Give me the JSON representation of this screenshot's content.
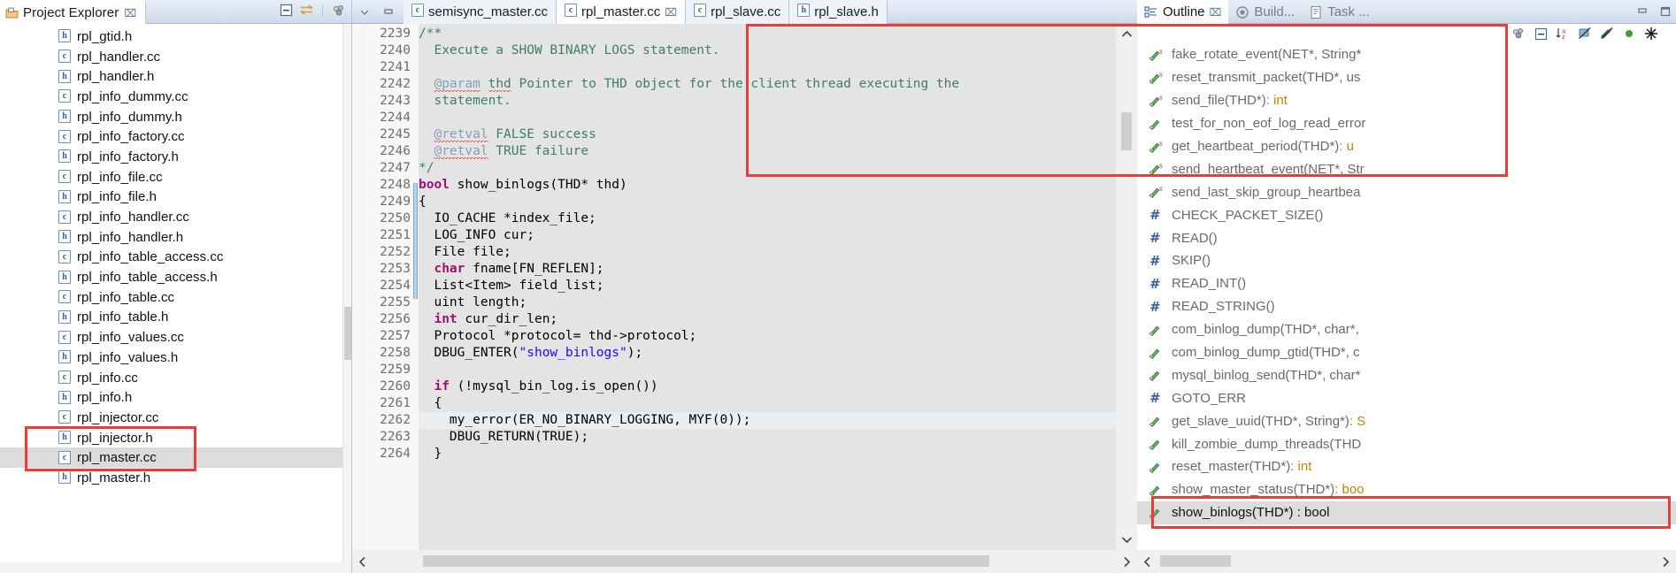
{
  "project_explorer": {
    "title": "Project Explorer",
    "close_label": "⌧",
    "icons": [
      "collapse-all-icon",
      "link-with-editor-icon",
      "view-menu-icon"
    ],
    "files": [
      {
        "name": "rpl_gtid.h",
        "type": "h"
      },
      {
        "name": "rpl_handler.cc",
        "type": "c"
      },
      {
        "name": "rpl_handler.h",
        "type": "h"
      },
      {
        "name": "rpl_info_dummy.cc",
        "type": "c"
      },
      {
        "name": "rpl_info_dummy.h",
        "type": "h"
      },
      {
        "name": "rpl_info_factory.cc",
        "type": "c"
      },
      {
        "name": "rpl_info_factory.h",
        "type": "h"
      },
      {
        "name": "rpl_info_file.cc",
        "type": "c"
      },
      {
        "name": "rpl_info_file.h",
        "type": "h"
      },
      {
        "name": "rpl_info_handler.cc",
        "type": "c"
      },
      {
        "name": "rpl_info_handler.h",
        "type": "h"
      },
      {
        "name": "rpl_info_table_access.cc",
        "type": "c"
      },
      {
        "name": "rpl_info_table_access.h",
        "type": "h"
      },
      {
        "name": "rpl_info_table.cc",
        "type": "c"
      },
      {
        "name": "rpl_info_table.h",
        "type": "h"
      },
      {
        "name": "rpl_info_values.cc",
        "type": "c"
      },
      {
        "name": "rpl_info_values.h",
        "type": "h"
      },
      {
        "name": "rpl_info.cc",
        "type": "c"
      },
      {
        "name": "rpl_info.h",
        "type": "h"
      },
      {
        "name": "rpl_injector.cc",
        "type": "c"
      },
      {
        "name": "rpl_injector.h",
        "type": "h"
      },
      {
        "name": "rpl_master.cc",
        "type": "c",
        "selected": true
      },
      {
        "name": "rpl_master.h",
        "type": "h"
      }
    ]
  },
  "editor": {
    "panel_controls": [
      "view-menu-icon",
      "minimize-icon",
      "maximize-icon"
    ],
    "tabs": [
      {
        "label": "semisync_master.cc",
        "active": false,
        "closable": false
      },
      {
        "label": "rpl_master.cc",
        "active": true,
        "closable": true
      },
      {
        "label": "rpl_slave.cc",
        "active": false,
        "closable": false
      },
      {
        "label": "rpl_slave.h",
        "active": false,
        "closable": false,
        "type": "h"
      }
    ],
    "close_label": "⌧",
    "first_line_number": 2239,
    "lines": [
      {
        "n": 2239,
        "fold": true,
        "tokens": [
          {
            "t": "/**",
            "c": "cmt"
          }
        ]
      },
      {
        "n": 2240,
        "tokens": [
          {
            "t": "  Execute a SHOW BINARY LOGS statement.",
            "c": "cmt"
          }
        ]
      },
      {
        "n": 2241,
        "tokens": [
          {
            "t": "",
            "c": "cmt"
          }
        ]
      },
      {
        "n": 2242,
        "tokens": [
          {
            "t": "  ",
            "c": "cmt"
          },
          {
            "t": "@param",
            "c": "cmt-tag squiggle"
          },
          {
            "t": " ",
            "c": "cmt"
          },
          {
            "t": "thd",
            "c": "cmt squiggle"
          },
          {
            "t": " Pointer to THD object for the client thread executing the",
            "c": "cmt"
          }
        ]
      },
      {
        "n": 2243,
        "tokens": [
          {
            "t": "  statement.",
            "c": "cmt"
          }
        ]
      },
      {
        "n": 2244,
        "tokens": [
          {
            "t": "",
            "c": "cmt"
          }
        ]
      },
      {
        "n": 2245,
        "tokens": [
          {
            "t": "  ",
            "c": "cmt"
          },
          {
            "t": "@retval",
            "c": "cmt-tag squiggle"
          },
          {
            "t": " FALSE success",
            "c": "cmt"
          }
        ]
      },
      {
        "n": 2246,
        "tokens": [
          {
            "t": "  ",
            "c": "cmt"
          },
          {
            "t": "@retval",
            "c": "cmt-tag squiggle"
          },
          {
            "t": " TRUE failure",
            "c": "cmt"
          }
        ]
      },
      {
        "n": 2247,
        "tokens": [
          {
            "t": "*/",
            "c": "cmt"
          }
        ]
      },
      {
        "n": 2248,
        "fold": true,
        "changed": true,
        "tokens": [
          {
            "t": "bool",
            "c": "kw"
          },
          {
            "t": " show_binlogs(THD* thd)",
            "c": "fn"
          }
        ]
      },
      {
        "n": 2249,
        "changed": true,
        "tokens": [
          {
            "t": "{",
            "c": "fn"
          }
        ]
      },
      {
        "n": 2250,
        "changed": true,
        "tokens": [
          {
            "t": "  IO_CACHE *index_file;",
            "c": "fn"
          }
        ]
      },
      {
        "n": 2251,
        "changed": true,
        "tokens": [
          {
            "t": "  LOG_INFO cur;",
            "c": "fn"
          }
        ]
      },
      {
        "n": 2252,
        "changed": true,
        "tokens": [
          {
            "t": "  File file;",
            "c": "fn"
          }
        ]
      },
      {
        "n": 2253,
        "changed": true,
        "tokens": [
          {
            "t": "  ",
            "c": "fn"
          },
          {
            "t": "char",
            "c": "kw"
          },
          {
            "t": " fname[FN_REFLEN];",
            "c": "fn"
          }
        ]
      },
      {
        "n": 2254,
        "changed": true,
        "tokens": [
          {
            "t": "  List<Item> field_list;",
            "c": "fn"
          }
        ]
      },
      {
        "n": 2255,
        "changed": true,
        "tokens": [
          {
            "t": "  uint length;",
            "c": "fn"
          }
        ]
      },
      {
        "n": 2256,
        "changed": true,
        "tokens": [
          {
            "t": "  ",
            "c": "fn"
          },
          {
            "t": "int",
            "c": "kw"
          },
          {
            "t": " cur_dir_len;",
            "c": "fn"
          }
        ]
      },
      {
        "n": 2257,
        "changed": true,
        "tokens": [
          {
            "t": "  Protocol *protocol= thd->protocol;",
            "c": "fn"
          }
        ]
      },
      {
        "n": 2258,
        "changed": true,
        "tokens": [
          {
            "t": "  DBUG_ENTER(",
            "c": "fn"
          },
          {
            "t": "\"show_binlogs\"",
            "c": "str"
          },
          {
            "t": ");",
            "c": "fn"
          }
        ]
      },
      {
        "n": 2259,
        "changed": true,
        "tokens": [
          {
            "t": "",
            "c": "fn"
          }
        ]
      },
      {
        "n": 2260,
        "changed": true,
        "tokens": [
          {
            "t": "  ",
            "c": "fn"
          },
          {
            "t": "if",
            "c": "kw"
          },
          {
            "t": " (!mysql_bin_log.is_open())",
            "c": "fn"
          }
        ]
      },
      {
        "n": 2261,
        "changed": true,
        "tokens": [
          {
            "t": "  {",
            "c": "fn"
          }
        ]
      },
      {
        "n": 2262,
        "highlight": true,
        "tokens": [
          {
            "t": "    my_error(ER_NO_BINARY_LOGGING, MYF(0));",
            "c": "fn"
          }
        ]
      },
      {
        "n": 2263,
        "tokens": [
          {
            "t": "    DBUG_RETURN(TRUE);",
            "c": "fn"
          }
        ]
      },
      {
        "n": 2264,
        "tokens": [
          {
            "t": "  }",
            "c": "fn"
          }
        ]
      }
    ]
  },
  "outline": {
    "tabs": [
      {
        "label": "Outline",
        "active": true,
        "closable": true,
        "icon": "outline-icon"
      },
      {
        "label": "Build...",
        "active": false,
        "icon": "build-console-icon"
      },
      {
        "label": "Task ...",
        "active": false,
        "icon": "task-list-icon"
      }
    ],
    "close_label": "⌧",
    "toolbar_icons": [
      "view-menu-icon",
      "collapse-all-icon",
      "sort-alphabetically-icon",
      "hide-fields-icon",
      "hide-static-icon",
      "hide-non-public-icon",
      "focus-icon"
    ],
    "items": [
      {
        "label": "fake_rotate_event(NET*, String*",
        "icon": "function-static",
        "ret": ""
      },
      {
        "label": "reset_transmit_packet(THD*, us",
        "icon": "function-static",
        "ret": ""
      },
      {
        "label": "send_file(THD*)",
        "icon": "function-static",
        "ret": " : int"
      },
      {
        "label": "test_for_non_eof_log_read_error",
        "icon": "function",
        "ret": ""
      },
      {
        "label": "get_heartbeat_period(THD*)",
        "icon": "function-static",
        "ret": " : u"
      },
      {
        "label": "send_heartbeat_event(NET*, Str",
        "icon": "function-static",
        "ret": ""
      },
      {
        "label": "send_last_skip_group_heartbea",
        "icon": "function-static",
        "ret": ""
      },
      {
        "label": "CHECK_PACKET_SIZE()",
        "icon": "macro",
        "ret": ""
      },
      {
        "label": "READ()",
        "icon": "macro",
        "ret": ""
      },
      {
        "label": "SKIP()",
        "icon": "macro",
        "ret": ""
      },
      {
        "label": "READ_INT()",
        "icon": "macro",
        "ret": ""
      },
      {
        "label": "READ_STRING()",
        "icon": "macro",
        "ret": ""
      },
      {
        "label": "com_binlog_dump(THD*, char*,",
        "icon": "function",
        "ret": ""
      },
      {
        "label": "com_binlog_dump_gtid(THD*, c",
        "icon": "function",
        "ret": ""
      },
      {
        "label": "mysql_binlog_send(THD*, char*",
        "icon": "function",
        "ret": ""
      },
      {
        "label": "GOTO_ERR",
        "icon": "macro",
        "ret": ""
      },
      {
        "label": "get_slave_uuid(THD*, String*)",
        "icon": "function",
        "ret": " : S"
      },
      {
        "label": "kill_zombie_dump_threads(THD",
        "icon": "function",
        "ret": ""
      },
      {
        "label": "reset_master(THD*)",
        "icon": "function",
        "ret": " : int"
      },
      {
        "label": "show_master_status(THD*)",
        "icon": "function",
        "ret": " : boo"
      },
      {
        "label": "show_binlogs(THD*) : bool",
        "icon": "function",
        "ret": "",
        "selected": true
      }
    ]
  },
  "annotations": {
    "color": "#ef3b34",
    "boxes": [
      "project-explorer-file-highlight",
      "doc-comment-highlight",
      "outline-item-highlight"
    ]
  }
}
